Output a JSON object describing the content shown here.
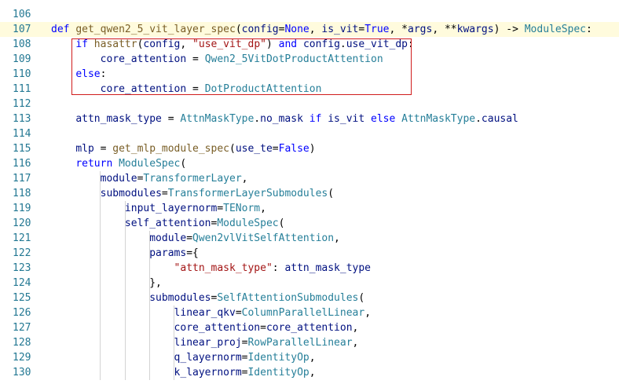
{
  "editor": {
    "current_line": "107",
    "lines": [
      {
        "ln": "106",
        "t": []
      },
      {
        "ln": "107",
        "t": [
          [
            "k",
            "def "
          ],
          [
            "f",
            "get_qwen2_5_vit_layer_spec"
          ],
          [
            "op",
            "("
          ],
          [
            "v",
            "config"
          ],
          [
            "op",
            "="
          ],
          [
            "c",
            "None"
          ],
          [
            "op",
            ", "
          ],
          [
            "v",
            "is_vit"
          ],
          [
            "op",
            "="
          ],
          [
            "c",
            "True"
          ],
          [
            "op",
            ", *"
          ],
          [
            "v",
            "args"
          ],
          [
            "op",
            ", **"
          ],
          [
            "v",
            "kwargs"
          ],
          [
            "op",
            ") -> "
          ],
          [
            "t",
            "ModuleSpec"
          ],
          [
            "op",
            ":"
          ]
        ]
      },
      {
        "ln": "108",
        "t": [
          [
            "op",
            "    "
          ],
          [
            "k",
            "if "
          ],
          [
            "f",
            "hasattr"
          ],
          [
            "op",
            "("
          ],
          [
            "v",
            "config"
          ],
          [
            "op",
            ", "
          ],
          [
            "s",
            "\"use_vit_dp\""
          ],
          [
            "op",
            ") "
          ],
          [
            "k",
            "and "
          ],
          [
            "v",
            "config"
          ],
          [
            "op",
            "."
          ],
          [
            "v",
            "use_vit_dp"
          ],
          [
            "op",
            ":"
          ]
        ]
      },
      {
        "ln": "109",
        "t": [
          [
            "op",
            "        "
          ],
          [
            "v",
            "core_attention"
          ],
          [
            "op",
            " = "
          ],
          [
            "t",
            "Qwen2_5VitDotProductAttention"
          ]
        ]
      },
      {
        "ln": "110",
        "t": [
          [
            "op",
            "    "
          ],
          [
            "k",
            "else"
          ],
          [
            "op",
            ":"
          ]
        ]
      },
      {
        "ln": "111",
        "t": [
          [
            "op",
            "        "
          ],
          [
            "v",
            "core_attention"
          ],
          [
            "op",
            " = "
          ],
          [
            "t",
            "DotProductAttention"
          ]
        ]
      },
      {
        "ln": "112",
        "t": []
      },
      {
        "ln": "113",
        "t": [
          [
            "op",
            "    "
          ],
          [
            "v",
            "attn_mask_type"
          ],
          [
            "op",
            " = "
          ],
          [
            "t",
            "AttnMaskType"
          ],
          [
            "op",
            "."
          ],
          [
            "v",
            "no_mask"
          ],
          [
            "op",
            " "
          ],
          [
            "k",
            "if "
          ],
          [
            "v",
            "is_vit"
          ],
          [
            "op",
            " "
          ],
          [
            "k",
            "else "
          ],
          [
            "t",
            "AttnMaskType"
          ],
          [
            "op",
            "."
          ],
          [
            "v",
            "causal"
          ]
        ]
      },
      {
        "ln": "114",
        "t": []
      },
      {
        "ln": "115",
        "t": [
          [
            "op",
            "    "
          ],
          [
            "v",
            "mlp"
          ],
          [
            "op",
            " = "
          ],
          [
            "f",
            "get_mlp_module_spec"
          ],
          [
            "op",
            "("
          ],
          [
            "v",
            "use_te"
          ],
          [
            "op",
            "="
          ],
          [
            "c",
            "False"
          ],
          [
            "op",
            ")"
          ]
        ]
      },
      {
        "ln": "116",
        "t": [
          [
            "op",
            "    "
          ],
          [
            "k",
            "return "
          ],
          [
            "t",
            "ModuleSpec"
          ],
          [
            "op",
            "("
          ]
        ]
      },
      {
        "ln": "117",
        "t": [
          [
            "op",
            "        "
          ],
          [
            "v",
            "module"
          ],
          [
            "op",
            "="
          ],
          [
            "t",
            "TransformerLayer"
          ],
          [
            "op",
            ","
          ]
        ]
      },
      {
        "ln": "118",
        "t": [
          [
            "op",
            "        "
          ],
          [
            "v",
            "submodules"
          ],
          [
            "op",
            "="
          ],
          [
            "t",
            "TransformerLayerSubmodules"
          ],
          [
            "op",
            "("
          ]
        ]
      },
      {
        "ln": "119",
        "t": [
          [
            "op",
            "            "
          ],
          [
            "v",
            "input_layernorm"
          ],
          [
            "op",
            "="
          ],
          [
            "t",
            "TENorm"
          ],
          [
            "op",
            ","
          ]
        ]
      },
      {
        "ln": "120",
        "t": [
          [
            "op",
            "            "
          ],
          [
            "v",
            "self_attention"
          ],
          [
            "op",
            "="
          ],
          [
            "t",
            "ModuleSpec"
          ],
          [
            "op",
            "("
          ]
        ]
      },
      {
        "ln": "121",
        "t": [
          [
            "op",
            "                "
          ],
          [
            "v",
            "module"
          ],
          [
            "op",
            "="
          ],
          [
            "t",
            "Qwen2vlVitSelfAttention"
          ],
          [
            "op",
            ","
          ]
        ]
      },
      {
        "ln": "122",
        "t": [
          [
            "op",
            "                "
          ],
          [
            "v",
            "params"
          ],
          [
            "op",
            "={"
          ]
        ]
      },
      {
        "ln": "123",
        "t": [
          [
            "op",
            "                    "
          ],
          [
            "s",
            "\"attn_mask_type\""
          ],
          [
            "op",
            ": "
          ],
          [
            "v",
            "attn_mask_type"
          ]
        ]
      },
      {
        "ln": "124",
        "t": [
          [
            "op",
            "                },"
          ]
        ]
      },
      {
        "ln": "125",
        "t": [
          [
            "op",
            "                "
          ],
          [
            "v",
            "submodules"
          ],
          [
            "op",
            "="
          ],
          [
            "t",
            "SelfAttentionSubmodules"
          ],
          [
            "op",
            "("
          ]
        ]
      },
      {
        "ln": "126",
        "t": [
          [
            "op",
            "                    "
          ],
          [
            "v",
            "linear_qkv"
          ],
          [
            "op",
            "="
          ],
          [
            "t",
            "ColumnParallelLinear"
          ],
          [
            "op",
            ","
          ]
        ]
      },
      {
        "ln": "127",
        "t": [
          [
            "op",
            "                    "
          ],
          [
            "v",
            "core_attention"
          ],
          [
            "op",
            "="
          ],
          [
            "v",
            "core_attention"
          ],
          [
            "op",
            ","
          ]
        ]
      },
      {
        "ln": "128",
        "t": [
          [
            "op",
            "                    "
          ],
          [
            "v",
            "linear_proj"
          ],
          [
            "op",
            "="
          ],
          [
            "t",
            "RowParallelLinear"
          ],
          [
            "op",
            ","
          ]
        ]
      },
      {
        "ln": "129",
        "t": [
          [
            "op",
            "                    "
          ],
          [
            "v",
            "q_layernorm"
          ],
          [
            "op",
            "="
          ],
          [
            "t",
            "IdentityOp"
          ],
          [
            "op",
            ","
          ]
        ]
      },
      {
        "ln": "130",
        "t": [
          [
            "op",
            "                    "
          ],
          [
            "v",
            "k_layernorm"
          ],
          [
            "op",
            "="
          ],
          [
            "t",
            "IdentityOp"
          ],
          [
            "op",
            ","
          ]
        ]
      }
    ]
  }
}
